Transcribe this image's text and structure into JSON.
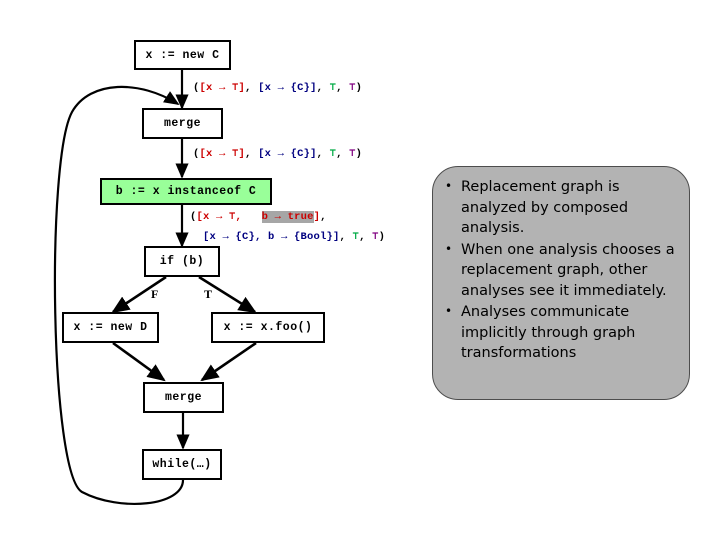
{
  "diagram": {
    "title": "control-flow-graph-with-dataflow-annotations",
    "nodes": [
      {
        "id": "new_c",
        "label": "x := new C"
      },
      {
        "id": "merge_top",
        "label": "merge"
      },
      {
        "id": "instanceof",
        "label": "b := x instanceof C"
      },
      {
        "id": "if_b",
        "label": "if (b)"
      },
      {
        "id": "new_d",
        "label": "x := new D"
      },
      {
        "id": "x_foo",
        "label": "x := x.foo()"
      },
      {
        "id": "merge_bot",
        "label": "merge"
      },
      {
        "id": "while_node",
        "label": "while(…)"
      }
    ],
    "branch_labels": {
      "false": "F",
      "true": "T"
    },
    "annotations": {
      "after_new_c": [
        {
          "text": "(",
          "color": "black"
        },
        {
          "text": "[x → ⊤]",
          "color": "red"
        },
        {
          "text": ", ",
          "color": "black"
        },
        {
          "text": "[x → {C}]",
          "color": "navy"
        },
        {
          "text": ", ",
          "color": "black"
        },
        {
          "text": "⊤",
          "color": "green"
        },
        {
          "text": ", ",
          "color": "black"
        },
        {
          "text": "⊤",
          "color": "purple"
        },
        {
          "text": ")",
          "color": "black"
        }
      ],
      "after_merge_top": [
        {
          "text": "(",
          "color": "black"
        },
        {
          "text": "[x → ⊤]",
          "color": "red"
        },
        {
          "text": ", ",
          "color": "black"
        },
        {
          "text": "[x → {C}]",
          "color": "navy"
        },
        {
          "text": ", ",
          "color": "black"
        },
        {
          "text": "⊤",
          "color": "green"
        },
        {
          "text": ", ",
          "color": "black"
        },
        {
          "text": "⊤",
          "color": "purple"
        },
        {
          "text": ")",
          "color": "black"
        }
      ],
      "after_instanceof_line1": [
        {
          "text": "(",
          "color": "black"
        },
        {
          "text": "[x → ⊤, ",
          "color": "red"
        },
        {
          "text": "  ",
          "color": "black"
        },
        {
          "text": "b → true",
          "color": "red",
          "highlight": true
        },
        {
          "text": "]",
          "color": "red"
        },
        {
          "text": ",",
          "color": "black"
        }
      ],
      "after_instanceof_line2": [
        {
          "text": "[x → {C}, b → {Bool}]",
          "color": "navy"
        },
        {
          "text": ", ",
          "color": "black"
        },
        {
          "text": "⊤",
          "color": "green"
        },
        {
          "text": ", ",
          "color": "black"
        },
        {
          "text": "⊤",
          "color": "purple"
        },
        {
          "text": ")",
          "color": "black"
        }
      ]
    }
  },
  "callout": {
    "bullets": [
      "Replacement graph is analyzed by composed analysis.",
      "When one analysis chooses a replacement graph, other analyses see it immediately.",
      "Analyses communicate implicitly through graph transformations"
    ]
  },
  "colors": {
    "node_fill": "#ffffff",
    "node_highlight_fill": "#99ff99",
    "node_border": "#000000",
    "callout_fill": "#b3b3b3",
    "callout_border": "#4d4d4d",
    "anno_red": "#cc0000",
    "anno_navy": "#000080",
    "anno_green": "#00aa44",
    "anno_purple": "#800080",
    "anno_highlight": "#a6a6a6"
  }
}
